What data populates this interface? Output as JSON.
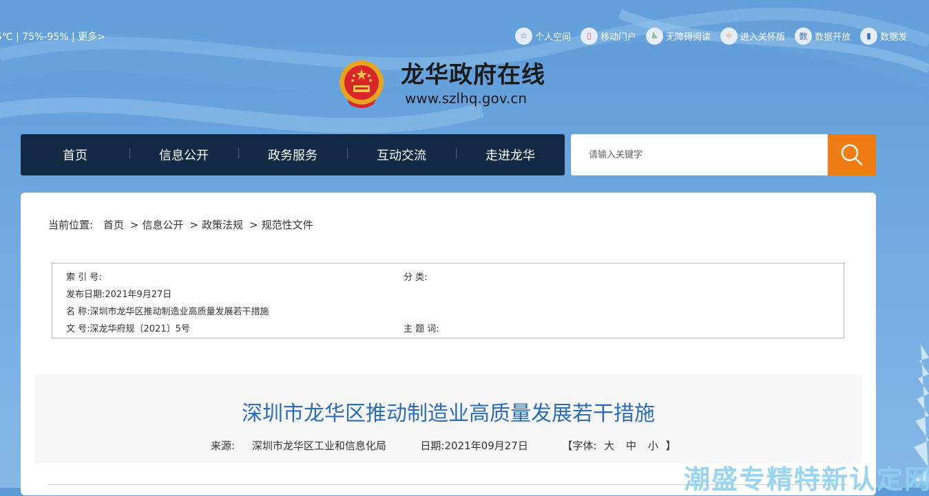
{
  "topbar": {
    "weather": "5℃ | 75%-95% | 更多>"
  },
  "toplinks": [
    {
      "label": "个人空间",
      "icon": "star-user-icon"
    },
    {
      "label": "移动门户",
      "icon": "mobile-icon"
    },
    {
      "label": "无障碍阅读",
      "icon": "accessibility-icon"
    },
    {
      "label": "进入关怀版",
      "icon": "care-icon"
    },
    {
      "label": "数据开放",
      "icon": "data-icon"
    },
    {
      "label": "数据发",
      "icon": "chart-icon"
    }
  ],
  "site": {
    "title": "龙华政府在线",
    "url": "www.szlhq.gov.cn"
  },
  "nav": [
    "首页",
    "信息公开",
    "政务服务",
    "互动交流",
    "走进龙华"
  ],
  "search": {
    "placeholder": "请输入关键字"
  },
  "breadcrumb": {
    "prefix": "当前位置:",
    "items": [
      "首页",
      "信息公开",
      "政策法规",
      "规范性文件"
    ],
    "sep": ">"
  },
  "meta": {
    "index_label": "索 引 号:",
    "index_value": "",
    "category_label": "分 类:",
    "category_value": "",
    "date_label": "发布日期:",
    "date_value": "2021年9月27日",
    "name_label": "名 称:",
    "name_value": "深圳市龙华区推动制造业高质量发展若干措施",
    "docno_label": "文 号:",
    "docno_value": "深龙华府规〔2021〕5号",
    "keyword_label": "主 题 词:",
    "keyword_value": ""
  },
  "article": {
    "title": "深圳市龙华区推动制造业高质量发展若干措施",
    "source_label": "来源:",
    "source_value": "深圳市龙华区工业和信息化局",
    "date_label": "日期:",
    "date_value": "2021年09月27日",
    "font_label": "【字体:",
    "font_large": "大",
    "font_medium": "中",
    "font_small": "小",
    "font_close": "】"
  },
  "watermark": "潮盛专精特新认定网",
  "colors": {
    "nav_bg": "#132a45",
    "search_btn": "#f07d14",
    "title": "#2c6db8"
  }
}
